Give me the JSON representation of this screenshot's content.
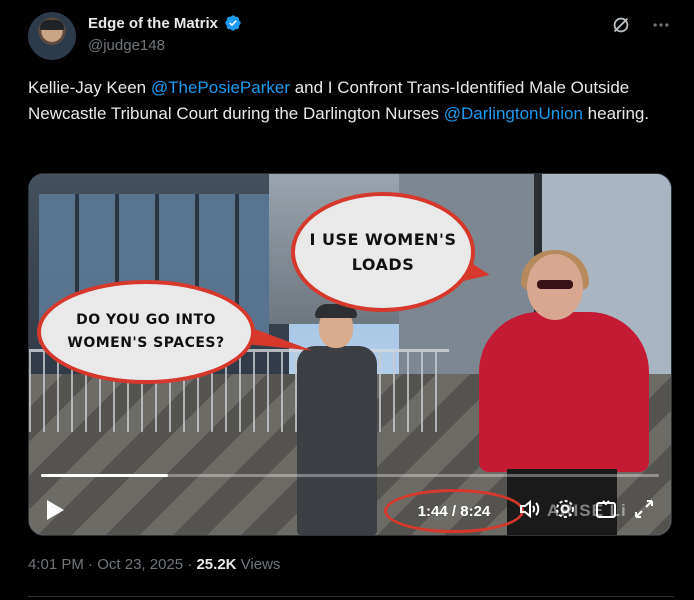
{
  "author": {
    "name": "Edge of the Matrix",
    "handle": "@judge148",
    "verified_color": "#1d9bf0"
  },
  "icons": [
    "verified-badge-icon",
    "grok-icon",
    "more-icon",
    "play-icon",
    "volume-icon",
    "settings-icon",
    "pip-icon",
    "fullscreen-icon"
  ],
  "tweet": {
    "text_1": "Kellie-Jay Keen ",
    "mention_1": "@ThePosieParker",
    "text_2": "  and I Confront Trans-Identified Male Outside Newcastle Tribunal Court during the Darlington Nurses ",
    "mention_2": "@DarlingtonUnion",
    "text_3": " hearing."
  },
  "video": {
    "bubble_1": "I USE WOMEN'S LOADS",
    "bubble_2": "DO YOU GO INTO WOMEN'S SPACES?",
    "time": "1:44 / 8:24",
    "progress": 0.206,
    "watermark": "ARISE Li",
    "accent_color": "#d6392c"
  },
  "meta": {
    "time": "4:01 PM",
    "sep1": " · ",
    "date": "Oct 23, 2025",
    "sep2": " · ",
    "views_count": "25.2K",
    "views_label": " Views"
  }
}
